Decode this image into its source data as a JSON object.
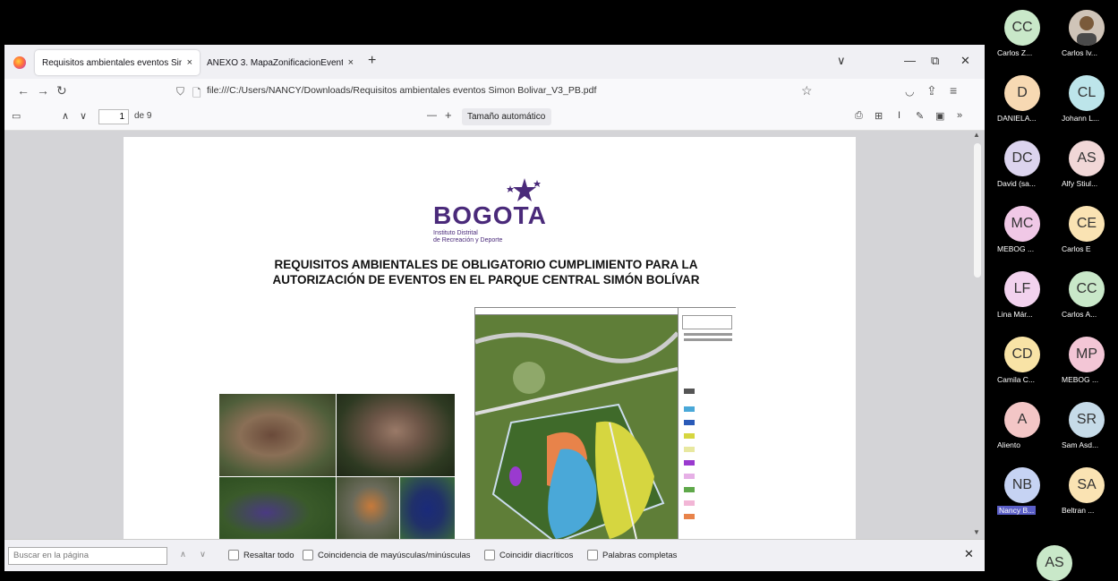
{
  "browser": {
    "tabs": [
      {
        "label": "Requisitos ambientales eventos Sim",
        "close": "×"
      },
      {
        "label": "ANEXO 3. MapaZonificacionEvento",
        "close": "×"
      }
    ],
    "new_tab": "+",
    "window_controls": {
      "list": "∨",
      "minimize": "—",
      "restore": "⧉",
      "close": "✕"
    },
    "url": "file:///C:/Users/NANCY/Downloads/Requisitos ambientales eventos Simon Bolivar_V3_PB.pdf"
  },
  "pdf_toolbar": {
    "page_number": "1",
    "page_total": "de 9",
    "zoom_out": "—",
    "zoom_in": "+",
    "zoom_select": "Tamaño automático"
  },
  "document": {
    "logo_text": "BOGOTA",
    "logo_sub1": "Instituto Distrital",
    "logo_sub2": "de Recreación y Deporte",
    "title_line1": "REQUISITOS AMBIENTALES DE OBLIGATORIO CUMPLIMIENTO PARA LA",
    "title_line2": "AUTORIZACIÓN DE EVENTOS EN EL PARQUE CENTRAL SIMÓN BOLÍVAR"
  },
  "find_bar": {
    "placeholder": "Buscar en la página",
    "options": [
      "Resaltar todo",
      "Coincidencia de mayúsculas/minúsculas",
      "Coincidir diacríticos",
      "Palabras completas"
    ],
    "close": "✕"
  },
  "participants": [
    {
      "initials": "CC",
      "name": "Carlos Z...",
      "color": "#c9e8c9"
    },
    {
      "initials": "",
      "name": "Carlos Iv...",
      "color": "#8a6a4a",
      "photo": true
    },
    {
      "initials": "D",
      "name": "DANIELA...",
      "color": "#f7d9b3"
    },
    {
      "initials": "CL",
      "name": "Johann L...",
      "color": "#bde5ea"
    },
    {
      "initials": "DC",
      "name": "David (sa...",
      "color": "#dcd4ee"
    },
    {
      "initials": "AS",
      "name": "Alfy Stiul...",
      "color": "#f1d7d7"
    },
    {
      "initials": "MC",
      "name": "MEBOG ...",
      "color": "#f0c8e6"
    },
    {
      "initials": "CE",
      "name": "Carlos E",
      "color": "#fae3b3"
    },
    {
      "initials": "LF",
      "name": "Lina Már...",
      "color": "#f2d2ee"
    },
    {
      "initials": "CC",
      "name": "Carlos A...",
      "color": "#c9e8c9"
    },
    {
      "initials": "CD",
      "name": "Camila C...",
      "color": "#f8e3a6"
    },
    {
      "initials": "MP",
      "name": "MEBOG ...",
      "color": "#f3c6d6"
    },
    {
      "initials": "A",
      "name": "Aliento",
      "color": "#f3c6c6"
    },
    {
      "initials": "SR",
      "name": "Sam Asd...",
      "color": "#c6dbe8"
    },
    {
      "initials": "NB",
      "name": "Nancy B...",
      "color": "#c6d3f3",
      "highlight": true
    },
    {
      "initials": "SA",
      "name": "Beltran ...",
      "color": "#fae3b3"
    },
    {
      "initials": "AS",
      "name": "",
      "color": "#c9e8c9"
    }
  ]
}
